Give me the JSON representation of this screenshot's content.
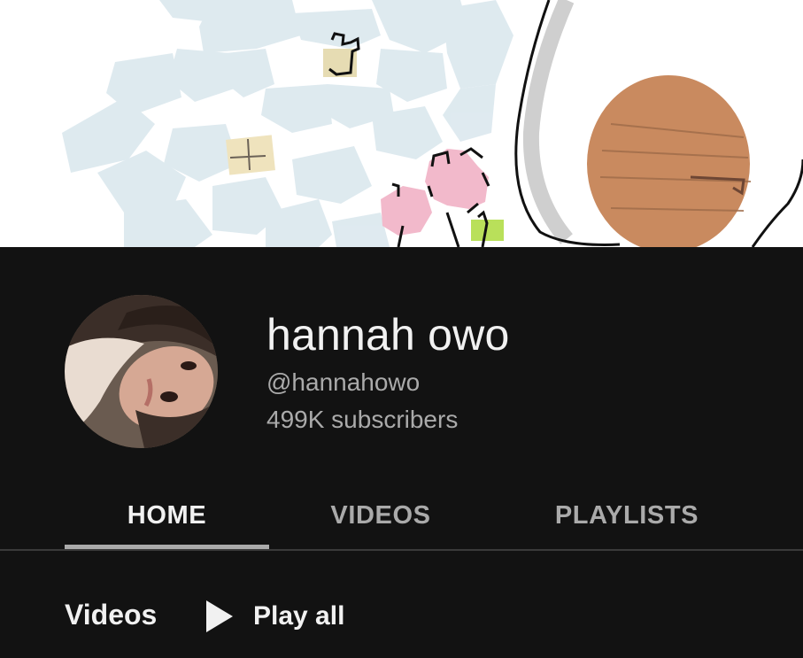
{
  "channel": {
    "name": "hannah owo",
    "handle": "@hannahowo",
    "subscribers": "499K subscribers"
  },
  "tabs": [
    {
      "label": "HOME",
      "active": true
    },
    {
      "label": "VIDEOS",
      "active": false
    },
    {
      "label": "PLAYLISTS",
      "active": false
    }
  ],
  "section": {
    "title": "Videos",
    "play_all_label": "Play all",
    "play_icon": "play-icon"
  },
  "colors": {
    "background": "#121212",
    "text_primary": "#f1f1f1",
    "text_secondary": "#aaaaaa",
    "banner_background": "#ffffff"
  }
}
